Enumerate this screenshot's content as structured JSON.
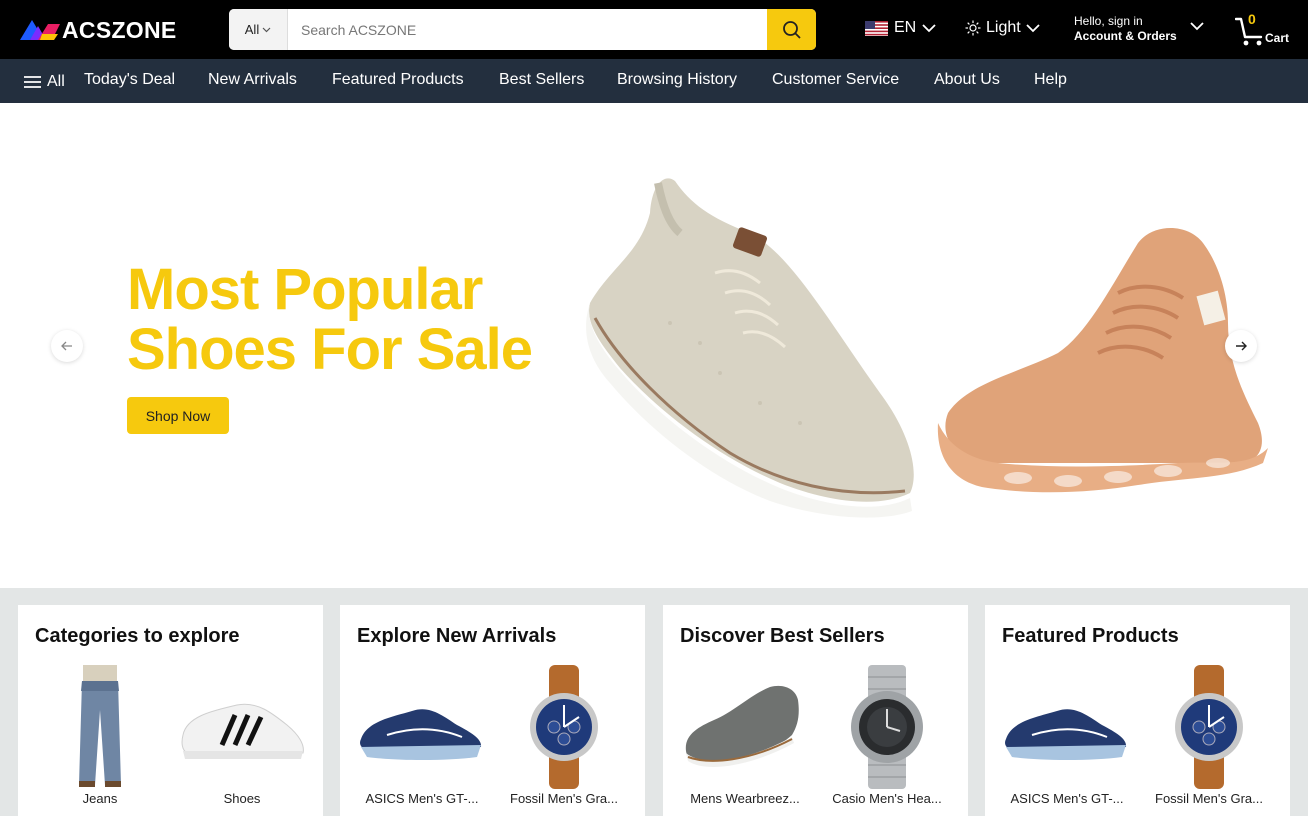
{
  "header": {
    "logo_text": "ACSZONE",
    "search": {
      "category": "All",
      "placeholder": "Search ACSZONE"
    },
    "language": "EN",
    "theme": "Light",
    "account": {
      "greeting": "Hello, sign in",
      "label": "Account & Orders"
    },
    "cart": {
      "count": "0",
      "label": "Cart"
    }
  },
  "nav": {
    "all_label": "All",
    "items": [
      "Today's Deal",
      "New Arrivals",
      "Featured Products",
      "Best Sellers",
      "Browsing History",
      "Customer Service",
      "About Us",
      "Help"
    ]
  },
  "hero": {
    "title_line1": "Most Popular",
    "title_line2": "Shoes For Sale",
    "button": "Shop Now"
  },
  "cards": [
    {
      "title": "Categories to explore",
      "items": [
        {
          "label": "Jeans",
          "image": "jeans"
        },
        {
          "label": "Shoes",
          "image": "white-sneaker"
        }
      ]
    },
    {
      "title": "Explore New Arrivals",
      "items": [
        {
          "label": "ASICS Men's GT-...",
          "image": "blue-running-shoe"
        },
        {
          "label": "Fossil Men's Gra...",
          "image": "brown-watch"
        }
      ]
    },
    {
      "title": "Discover Best Sellers",
      "items": [
        {
          "label": "Mens Wearbreez...",
          "image": "grey-shoe"
        },
        {
          "label": "Casio Men's Hea...",
          "image": "steel-watch"
        }
      ]
    },
    {
      "title": "Featured Products",
      "items": [
        {
          "label": "ASICS Men's GT-...",
          "image": "blue-running-shoe"
        },
        {
          "label": "Fossil Men's Gra...",
          "image": "brown-watch"
        }
      ]
    }
  ],
  "colors": {
    "accent": "#f6c90e",
    "topbar": "#000000",
    "navbar": "#232f3e",
    "lower_bg": "#e3e6e6"
  }
}
